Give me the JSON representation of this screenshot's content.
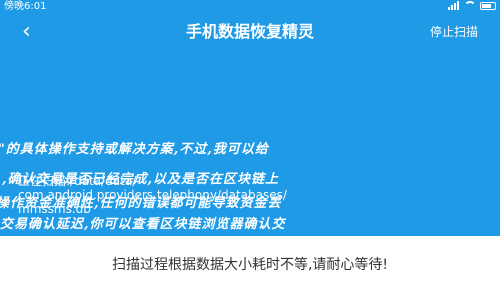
{
  "status_bar": {
    "time": "傍晚6:01"
  },
  "header": {
    "back_icon": "back-chevron-icon",
    "title": "手机数据恢复精灵",
    "stop_label": "停止扫描"
  },
  "overlay_text": {
    "line1": "\"的具体操作支持或解决方案,不过,我可以给",
    "line2": ",确认交易是否已经完成,以及是否在区块链上",
    "line3": "操作资金准确性,任何的错误都可能导致资金丢",
    "line4": "交易确认延迟,你可以查看区块链浏览器确认交"
  },
  "scan": {
    "line1": "正在扫描:/data/data/",
    "line2": "com.android.providers.telephony/databases/",
    "line3": "mmssms.db"
  },
  "hint": "扫描过程根据数据大小耗时不等,请耐心等待!",
  "colors": {
    "primary": "#1e9ae6",
    "text": "#333333"
  }
}
